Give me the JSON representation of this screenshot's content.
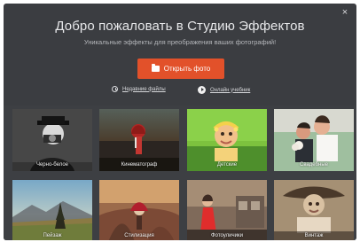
{
  "window": {
    "close_glyph": "×",
    "title": "Добро пожаловать в Студию Эффектов",
    "subtitle": "Уникальные эффекты для преображения ваших фотографий!",
    "open_button_label": "Открыть фото",
    "links": {
      "recent_label": "Недавние файлы",
      "tutorial_label": "Онлайн учебник"
    }
  },
  "gallery": {
    "items": [
      {
        "label": "Черно-белое"
      },
      {
        "label": "Кинематограф"
      },
      {
        "label": "Детские"
      },
      {
        "label": "Свадебные"
      },
      {
        "label": "Пейзаж"
      },
      {
        "label": "Стилизация"
      },
      {
        "label": "Фотоуличики"
      },
      {
        "label": "Винтаж"
      }
    ]
  },
  "colors": {
    "accent": "#e2512a",
    "background": "#3b3d41",
    "text": "#e6e7e9"
  },
  "icons": {
    "open": "folder-icon",
    "recent": "clock-icon",
    "tutorial": "play-icon",
    "close": "close-icon"
  }
}
